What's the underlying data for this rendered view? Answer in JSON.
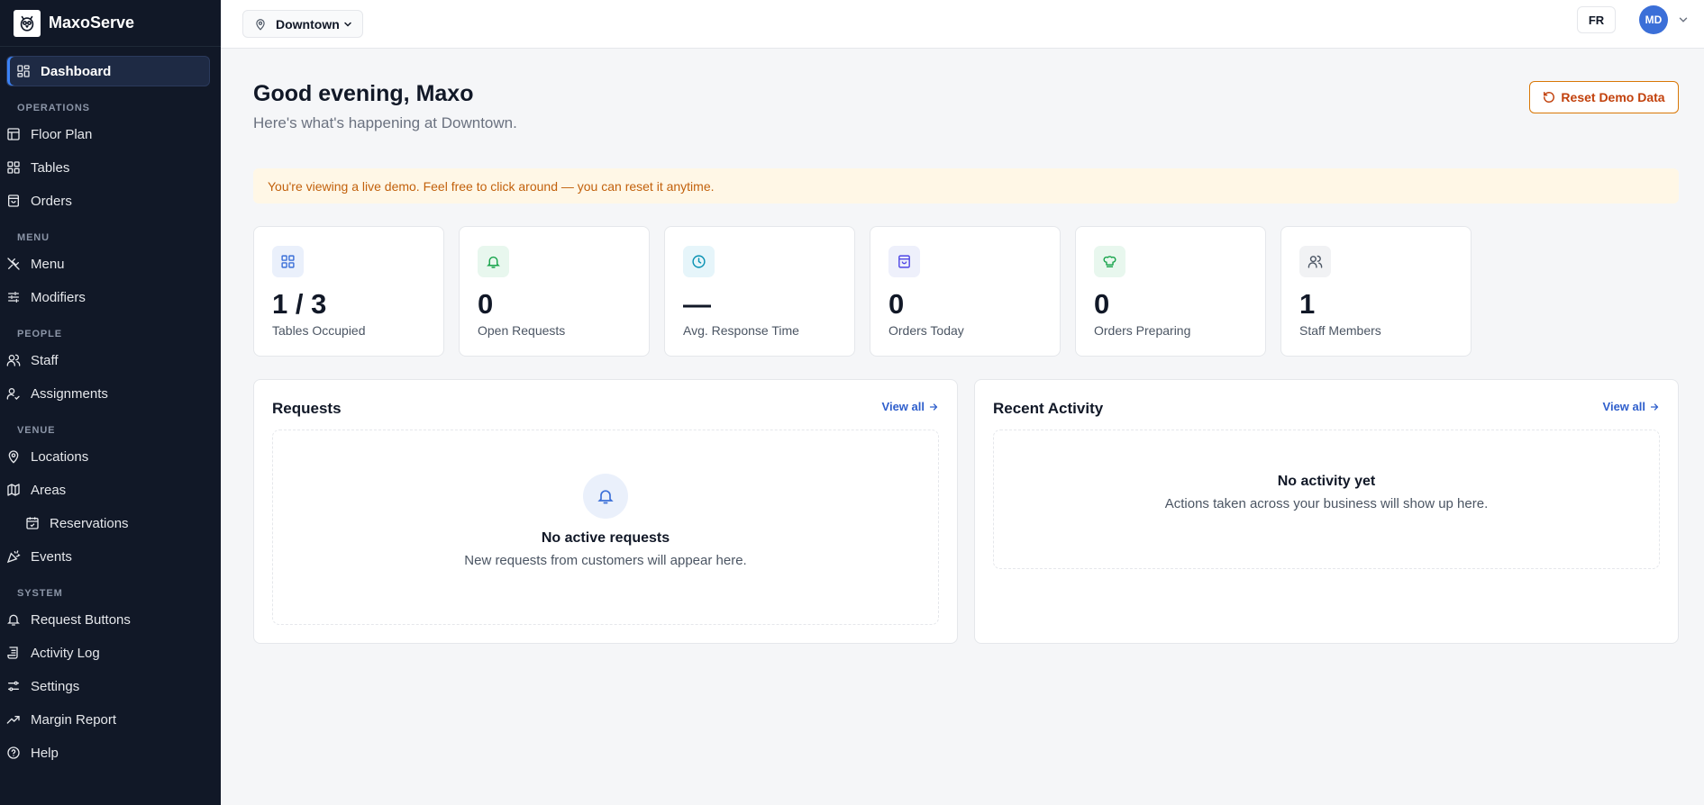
{
  "brand": {
    "name": "MaxoServe",
    "logo_icon": "owl-logo-icon"
  },
  "sidebar": {
    "active": {
      "label": "Dashboard",
      "icon": "grid-icon"
    },
    "sections": [
      {
        "title": "OPERATIONS",
        "items": [
          {
            "label": "Floor Plan",
            "icon": "layout-icon"
          },
          {
            "label": "Tables",
            "icon": "grid-icon"
          },
          {
            "label": "Orders",
            "icon": "shopping-bag-icon"
          }
        ]
      },
      {
        "title": "MENU",
        "items": [
          {
            "label": "Menu",
            "icon": "utensils-icon"
          },
          {
            "label": "Modifiers",
            "icon": "sliders-icon"
          }
        ]
      },
      {
        "title": "PEOPLE",
        "items": [
          {
            "label": "Staff",
            "icon": "users-icon"
          },
          {
            "label": "Assignments",
            "icon": "user-check-icon"
          }
        ]
      },
      {
        "title": "VENUE",
        "items": [
          {
            "label": "Locations",
            "icon": "map-pin-icon"
          },
          {
            "label": "Areas",
            "icon": "map-icon"
          },
          {
            "label": "Reservations",
            "icon": "calendar-icon"
          },
          {
            "label": "Events",
            "icon": "party-popper-icon"
          }
        ]
      },
      {
        "title": "SYSTEM",
        "items": [
          {
            "label": "Request Buttons",
            "icon": "bell-icon"
          },
          {
            "label": "Activity Log",
            "icon": "scroll-icon"
          },
          {
            "label": "Settings",
            "icon": "settings-icon"
          },
          {
            "label": "Margin Report",
            "icon": "trending-up-icon"
          },
          {
            "label": "Help",
            "icon": "help-circle-icon"
          }
        ]
      }
    ]
  },
  "topbar": {
    "location": "Downtown",
    "language": "FR",
    "avatar_initials": "MD"
  },
  "header": {
    "greeting": "Good evening, Maxo",
    "subtitle": "Here's what's happening at Downtown.",
    "reset_label": "Reset Demo Data"
  },
  "banner": {
    "text": "You're viewing a live demo. Feel free to click around — you can reset it anytime."
  },
  "stats": [
    {
      "value": "1 / 3",
      "label": "Tables Occupied",
      "icon": "grid-icon",
      "color": "#3b6fd8",
      "bg": "#eaf0fb"
    },
    {
      "value": "0",
      "label": "Open Requests",
      "icon": "bell-icon",
      "color": "#16a34a",
      "bg": "#e8f7ee"
    },
    {
      "value": "—",
      "label": "Avg. Response Time",
      "icon": "clock-icon",
      "color": "#0891b2",
      "bg": "#e6f5fa"
    },
    {
      "value": "0",
      "label": "Orders Today",
      "icon": "shopping-bag-icon",
      "color": "#4f46e5",
      "bg": "#eef0fb"
    },
    {
      "value": "0",
      "label": "Orders Preparing",
      "icon": "chef-hat-icon",
      "color": "#16a34a",
      "bg": "#e8f7ee"
    },
    {
      "value": "1",
      "label": "Staff Members",
      "icon": "users-icon",
      "color": "#4b5563",
      "bg": "#f1f2f4"
    }
  ],
  "requests": {
    "title": "Requests",
    "view_all": "View all",
    "empty_title": "No active requests",
    "empty_sub": "New requests from customers will appear here."
  },
  "activity": {
    "title": "Recent Activity",
    "view_all": "View all",
    "empty_title": "No activity yet",
    "empty_sub": "Actions taken across your business will show up here."
  }
}
